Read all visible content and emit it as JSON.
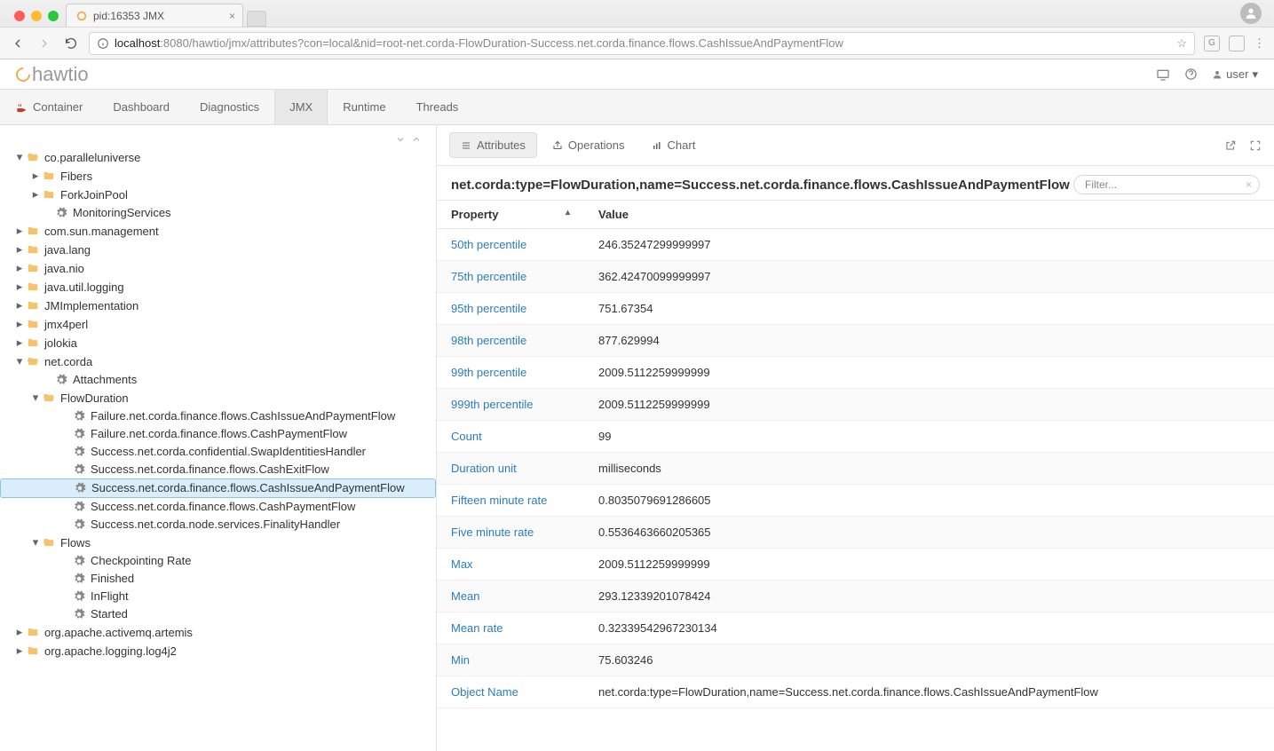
{
  "browser": {
    "tab_title": "pid:16353 JMX",
    "url_host": "localhost",
    "url_port": ":8080",
    "url_path": "/hawtio/jmx/attributes?con=local&nid=root-net.corda-FlowDuration-Success.net.corda.finance.flows.CashIssueAndPaymentFlow"
  },
  "app": {
    "brand": "hawtio",
    "user_label": "user"
  },
  "nav": {
    "container": "Container",
    "dashboard": "Dashboard",
    "diagnostics": "Diagnostics",
    "jmx": "JMX",
    "runtime": "Runtime",
    "threads": "Threads"
  },
  "sidebar": {
    "co_paralleluniverse": "co.paralleluniverse",
    "fibers": "Fibers",
    "forkjoinpool": "ForkJoinPool",
    "monitoringservices": "MonitoringServices",
    "com_sun_management": "com.sun.management",
    "java_lang": "java.lang",
    "java_nio": "java.nio",
    "java_util_logging": "java.util.logging",
    "jmimplementation": "JMImplementation",
    "jmx4perl": "jmx4perl",
    "jolokia": "jolokia",
    "net_corda": "net.corda",
    "attachments": "Attachments",
    "flowduration": "FlowDuration",
    "fd_failure_cashissueandpayment": "Failure.net.corda.finance.flows.CashIssueAndPaymentFlow",
    "fd_failure_cashpayment": "Failure.net.corda.finance.flows.CashPaymentFlow",
    "fd_success_swapidentities": "Success.net.corda.confidential.SwapIdentitiesHandler",
    "fd_success_cashexit": "Success.net.corda.finance.flows.CashExitFlow",
    "fd_success_cashissueandpayment": "Success.net.corda.finance.flows.CashIssueAndPaymentFlow",
    "fd_success_cashpayment": "Success.net.corda.finance.flows.CashPaymentFlow",
    "fd_success_finalityhandler": "Success.net.corda.node.services.FinalityHandler",
    "flows": "Flows",
    "checkpointing_rate": "Checkpointing Rate",
    "finished": "Finished",
    "inflight": "InFlight",
    "started": "Started",
    "org_apache_activemq_artemis": "org.apache.activemq.artemis",
    "org_apache_logging_log4j2": "org.apache.logging.log4j2"
  },
  "subtabs": {
    "attributes": "Attributes",
    "operations": "Operations",
    "chart": "Chart"
  },
  "mbean": "net.corda:type=FlowDuration,name=Success.net.corda.finance.flows.CashIssueAndPaymentFlow",
  "filter_placeholder": "Filter...",
  "table": {
    "col_property": "Property",
    "col_value": "Value",
    "rows": [
      {
        "k": "50th percentile",
        "v": "246.35247299999997"
      },
      {
        "k": "75th percentile",
        "v": "362.42470099999997"
      },
      {
        "k": "95th percentile",
        "v": "751.67354"
      },
      {
        "k": "98th percentile",
        "v": "877.629994"
      },
      {
        "k": "99th percentile",
        "v": "2009.5112259999999"
      },
      {
        "k": "999th percentile",
        "v": "2009.5112259999999"
      },
      {
        "k": "Count",
        "v": "99"
      },
      {
        "k": "Duration unit",
        "v": "milliseconds"
      },
      {
        "k": "Fifteen minute rate",
        "v": "0.8035079691286605"
      },
      {
        "k": "Five minute rate",
        "v": "0.5536463660205365"
      },
      {
        "k": "Max",
        "v": "2009.5112259999999"
      },
      {
        "k": "Mean",
        "v": "293.12339201078424"
      },
      {
        "k": "Mean rate",
        "v": "0.32339542967230134"
      },
      {
        "k": "Min",
        "v": "75.603246"
      },
      {
        "k": "Object Name",
        "v": "net.corda:type=FlowDuration,name=Success.net.corda.finance.flows.CashIssueAndPaymentFlow"
      }
    ]
  }
}
